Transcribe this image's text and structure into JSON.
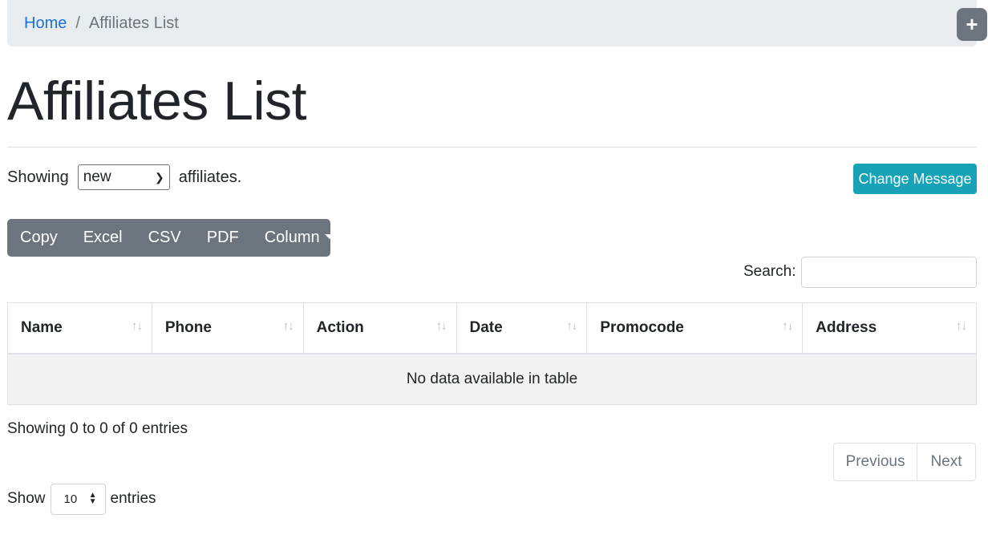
{
  "breadcrumb": {
    "home": "Home",
    "separator": "/",
    "current": "Affiliates List"
  },
  "fab": {
    "icon": "plus-icon",
    "label": "+"
  },
  "page": {
    "title": "Affiliates List"
  },
  "filter": {
    "prefix": "Showing",
    "selected": "new",
    "suffix": "affiliates."
  },
  "change_message_label": "Change Message",
  "toolbar": {
    "copy": "Copy",
    "excel": "Excel",
    "csv": "CSV",
    "pdf": "PDF",
    "column": "Column"
  },
  "search": {
    "label": "Search:",
    "value": ""
  },
  "table": {
    "columns": [
      "Name",
      "Phone",
      "Action",
      "Date",
      "Promocode",
      "Address"
    ],
    "sort_glyph": "↑↓",
    "empty_message": "No data available in table"
  },
  "info": "Showing 0 to 0 of 0 entries",
  "pagination": {
    "previous": "Previous",
    "next": "Next"
  },
  "length": {
    "prefix": "Show",
    "value": "10",
    "suffix": "entries"
  },
  "colors": {
    "breadcrumb_bg": "#e9ecef",
    "link": "#1a73d9",
    "secondary": "#6c757d",
    "info_button": "#17a2b8",
    "empty_row_bg": "#f2f2f2"
  }
}
